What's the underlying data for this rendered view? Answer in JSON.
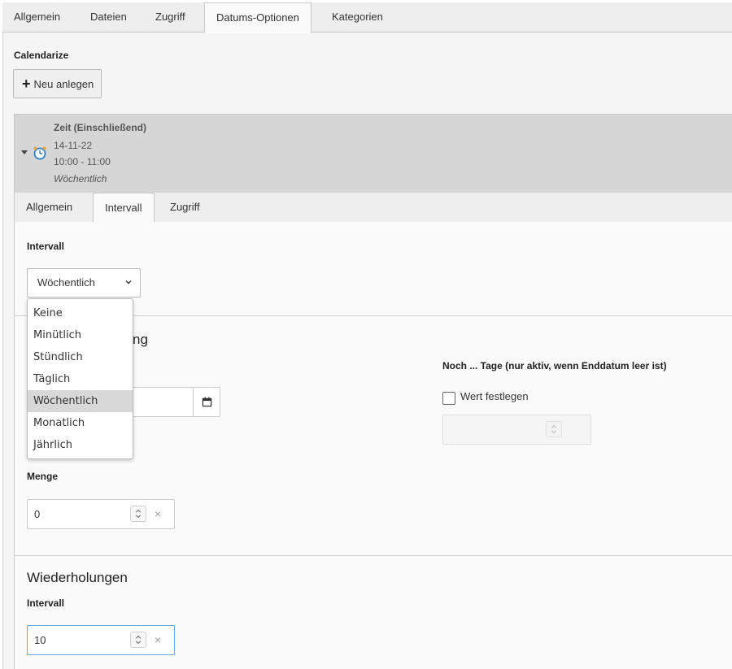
{
  "outer_tabs": [
    {
      "label": "Allgemein"
    },
    {
      "label": "Dateien"
    },
    {
      "label": "Zugriff"
    },
    {
      "label": "Datums-Optionen",
      "active": true
    },
    {
      "label": "Kategorien"
    }
  ],
  "section_label": "Calendarize",
  "new_button": {
    "icon": "plus-icon",
    "label": "Neu anlegen"
  },
  "record": {
    "title": "Zeit (Einschließend)",
    "date": "14-11-22",
    "time_range": "10:00 - 11:00",
    "frequency": "Wöchentlich",
    "icon": "alarm-clock-icon"
  },
  "inner_tabs": [
    {
      "label": "Allgemein"
    },
    {
      "label": "Intervall",
      "active": true
    },
    {
      "label": "Zugriff"
    }
  ],
  "intervall": {
    "label": "Intervall",
    "selected": "Wöchentlich",
    "options": [
      "Keine",
      "Minütlich",
      "Stündlich",
      "Täglich",
      "Wöchentlich",
      "Monatlich",
      "Jährlich"
    ]
  },
  "partial_heading": "ng",
  "noch_tage": {
    "label": "Noch ... Tage (nur aktiv, wenn Enddatum leer ist)",
    "checkbox_label": "Wert festlegen"
  },
  "menge": {
    "label": "Menge",
    "value": "0"
  },
  "wiederholungen": {
    "heading": "Wiederholungen",
    "label": "Intervall",
    "value": "10"
  }
}
